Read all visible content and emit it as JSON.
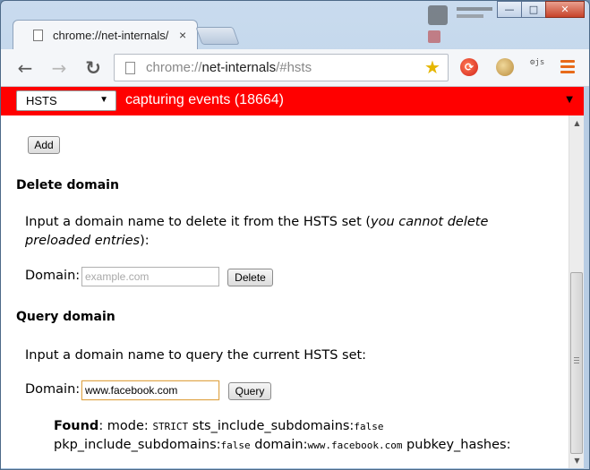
{
  "window": {
    "controls": {
      "minimize": "—",
      "maximize": "□",
      "close": "✕"
    }
  },
  "tabs": [
    {
      "title": "chrome://net-internals/",
      "close": "×"
    }
  ],
  "toolbar": {
    "back_icon": "arrow-left-icon",
    "forward_icon": "arrow-right-icon",
    "reload_icon": "reload-icon",
    "url_prefix": "chrome://",
    "url_host": "net-internals",
    "url_path": "/#hsts",
    "star_icon": "star-icon",
    "ext_icons": [
      "red-extension-icon",
      "cookie-extension-icon",
      "js-extension-icon"
    ],
    "ext3_text": "js",
    "menu_icon": "hamburger-menu-icon"
  },
  "capture_bar": {
    "color": "#ff0000",
    "view_selected": "HSTS",
    "status": "capturing events (18664)"
  },
  "add_section": {
    "add_button": "Add"
  },
  "delete_section": {
    "title": "Delete domain",
    "intro": "Input a domain name to delete it from the HSTS set (",
    "intro_em": "you cannot delete preloaded entries",
    "intro_end": "):",
    "domain_label": "Domain:",
    "placeholder": "example.com",
    "button": "Delete"
  },
  "query_section": {
    "title": "Query domain",
    "intro": "Input a domain name to query the current HSTS set:",
    "domain_label": "Domain:",
    "value": "www.facebook.com",
    "button": "Query",
    "result": {
      "found": "Found",
      "mode_label": ": mode: ",
      "mode": "STRICT",
      "sts_label": " sts_include_subdomains:",
      "sts": "false",
      "pkp_label": "pkp_include_subdomains:",
      "pkp": "false",
      "domain_label": " domain:",
      "domain": "www.facebook.com",
      "pubkey_label": " pubkey_hashes:"
    }
  }
}
